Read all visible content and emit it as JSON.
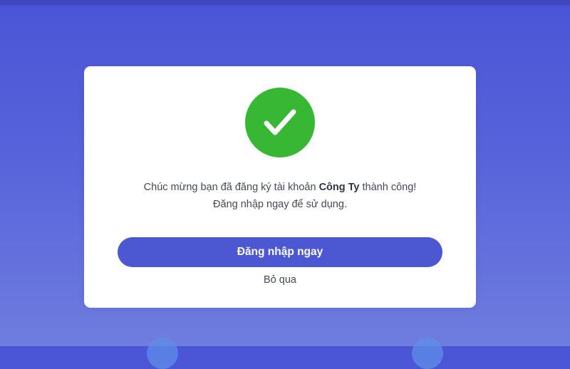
{
  "dialog": {
    "message_before": "Chúc mừng bạn đã đăng ký tài khoản ",
    "company": "Công Ty",
    "message_after": " thành công!",
    "message_line2": "Đăng nhập ngay để sử dụng.",
    "login_button": "Đăng nhập ngay",
    "skip_link": "Bỏ qua"
  },
  "colors": {
    "background": "#4f5bd8",
    "success": "#37b733",
    "primary_button": "#4c57d2"
  },
  "icons": {
    "success": "checkmark-icon"
  }
}
